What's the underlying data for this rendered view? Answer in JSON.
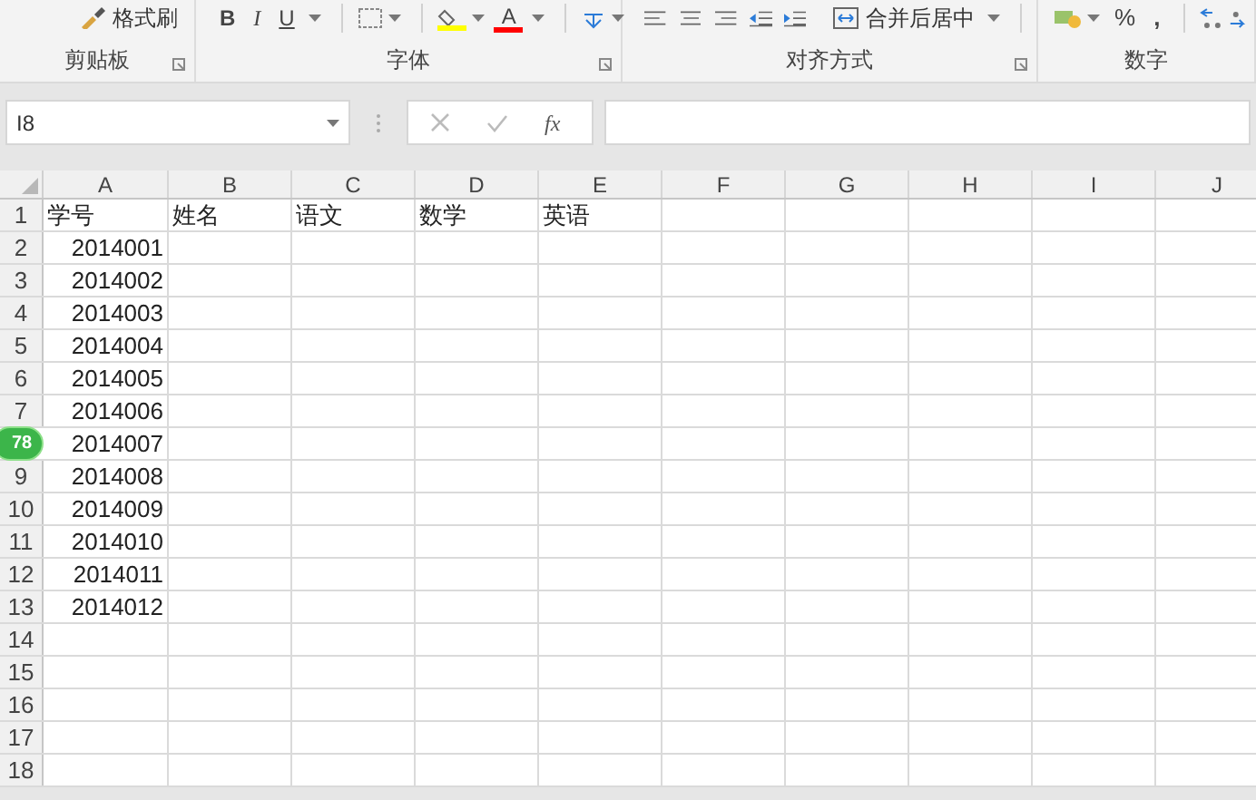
{
  "ribbon": {
    "groups": [
      {
        "label": "剪贴板",
        "launcher": true,
        "items": [
          {
            "kind": "brush",
            "text": "格式刷"
          }
        ]
      },
      {
        "label": "字体",
        "launcher": true,
        "items": [
          {
            "kind": "bold",
            "text": "B"
          },
          {
            "kind": "italic",
            "text": "I"
          },
          {
            "kind": "underline",
            "text": "U"
          },
          {
            "kind": "border"
          },
          {
            "kind": "fill"
          },
          {
            "kind": "fontcolor",
            "text": "A"
          },
          {
            "kind": "phonetic"
          }
        ]
      },
      {
        "label": "对齐方式",
        "launcher": true,
        "items": [
          {
            "kind": "alignleft"
          },
          {
            "kind": "aligncenter"
          },
          {
            "kind": "alignright"
          },
          {
            "kind": "outdent"
          },
          {
            "kind": "indent"
          },
          {
            "kind": "merge",
            "text": "合并后居中"
          }
        ]
      },
      {
        "label": "数字",
        "launcher": false,
        "items": [
          {
            "kind": "currency"
          },
          {
            "kind": "percent",
            "text": "%"
          },
          {
            "kind": "comma",
            "text": ","
          },
          {
            "kind": "decimals"
          }
        ]
      }
    ]
  },
  "formula_bar": {
    "name_box": "I8",
    "function_label": "fx"
  },
  "sheet": {
    "columns": [
      "A",
      "B",
      "C",
      "D",
      "E",
      "F",
      "G",
      "H",
      "I",
      "J"
    ],
    "rows": [
      {
        "number": "1",
        "cells": [
          "学号",
          "姓名",
          "语文",
          "数学",
          "英语"
        ]
      },
      {
        "number": "2",
        "cells": [
          "2014001"
        ]
      },
      {
        "number": "3",
        "cells": [
          "2014002"
        ]
      },
      {
        "number": "4",
        "cells": [
          "2014003"
        ]
      },
      {
        "number": "5",
        "cells": [
          "2014004"
        ]
      },
      {
        "number": "6",
        "cells": [
          "2014005"
        ]
      },
      {
        "number": "7",
        "cells": [
          "2014006"
        ]
      },
      {
        "cells": [
          "2014007"
        ]
      },
      {
        "number": "9",
        "cells": [
          "2014008"
        ]
      },
      {
        "number": "10",
        "cells": [
          "2014009"
        ]
      },
      {
        "number": "11",
        "cells": [
          "2014010"
        ]
      },
      {
        "number": "12",
        "cells": [
          "2014011"
        ]
      },
      {
        "number": "13",
        "cells": [
          "2014012"
        ]
      },
      {
        "number": "14",
        "cells": []
      },
      {
        "number": "15",
        "cells": []
      },
      {
        "number": "16",
        "cells": []
      },
      {
        "number": "17",
        "cells": []
      },
      {
        "number": "18",
        "cells": []
      }
    ]
  },
  "floating_badge": {
    "text": "78"
  }
}
